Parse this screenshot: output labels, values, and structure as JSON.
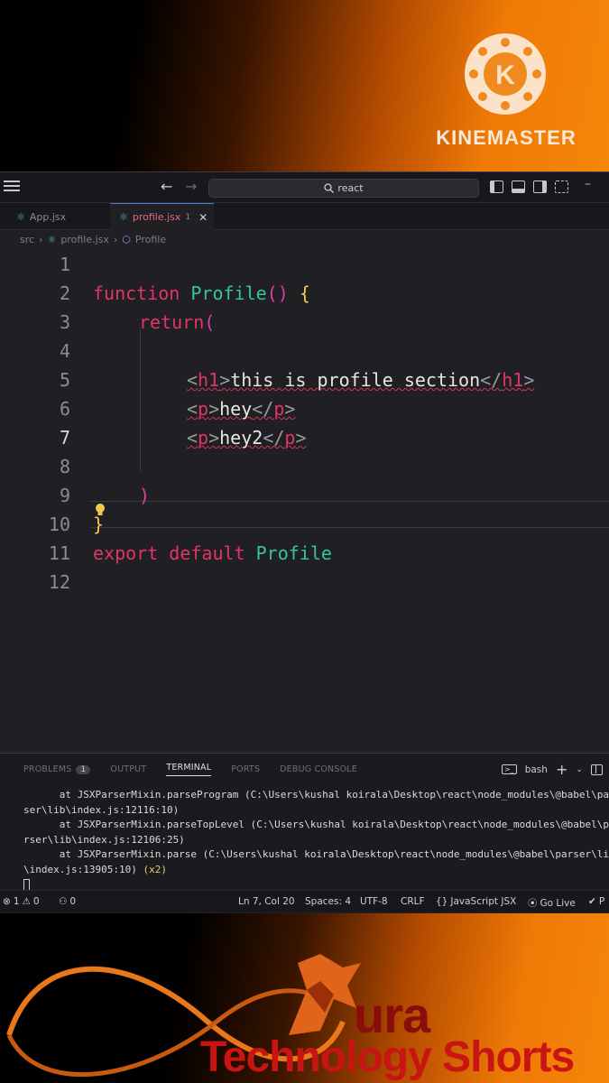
{
  "watermark": {
    "brand": "KINEMASTER"
  },
  "titlebar": {
    "search_text": "react"
  },
  "tabs": [
    {
      "label": "App.jsx"
    },
    {
      "label": "profile.jsx",
      "badge": "1"
    }
  ],
  "breadcrumb": [
    "src",
    "profile.jsx",
    "Profile"
  ],
  "code": {
    "line_numbers": [
      "1",
      "2",
      "3",
      "4",
      "5",
      "6",
      "7",
      "8",
      "9",
      "10",
      "11",
      "12"
    ],
    "l2": {
      "kw": "function",
      "fn": "Profile",
      "paren": "()",
      "brace": "{"
    },
    "l3": {
      "kw": "return",
      "paren": "("
    },
    "l5": {
      "lt": "<",
      "tag_open": "h1",
      "gt": ">",
      "text": "this is profile section",
      "lt2": "</",
      "tag_close": "h1",
      "gt2": ">"
    },
    "l6": {
      "lt": "<",
      "tag_open": "p",
      "gt": ">",
      "text": "hey",
      "lt2": "</",
      "tag_close": "p",
      "gt2": ">"
    },
    "l7": {
      "lt": "<",
      "tag_open": "p",
      "gt": ">",
      "text": "hey2",
      "lt2": "</",
      "tag_close": "p",
      "gt2": ">"
    },
    "l9": {
      "paren": ")"
    },
    "l10": {
      "brace": "}"
    },
    "l11": {
      "kw1": "export",
      "kw2": "default",
      "fn": "Profile"
    }
  },
  "panel": {
    "tabs": [
      "PROBLEMS",
      "OUTPUT",
      "TERMINAL",
      "PORTS",
      "DEBUG CONSOLE"
    ],
    "problems_count": "1",
    "shell": "bash",
    "terminal_lines": [
      "      at JSXParserMixin.parseProgram (C:\\Users\\kushal koirala\\Desktop\\react\\node_modules\\@babel\\pa",
      "ser\\lib\\index.js:12116:10)",
      "      at JSXParserMixin.parseTopLevel (C:\\Users\\kushal koirala\\Desktop\\react\\node_modules\\@babel\\p",
      "rser\\lib\\index.js:12106:25)",
      "      at JSXParserMixin.parse (C:\\Users\\kushal koirala\\Desktop\\react\\node_modules\\@babel\\parser\\lib",
      "\\index.js:13905:10)"
    ],
    "repeat": "(x2)"
  },
  "status_bar": {
    "errors": "1",
    "warnings": "0",
    "ports": "0",
    "position": "Ln 7, Col 20",
    "spaces": "Spaces: 4",
    "encoding": "UTF-8",
    "eol": "CRLF",
    "language": "JavaScript JSX",
    "golive": "Go Live",
    "prettier": "P"
  },
  "branding": {
    "aura": "ura",
    "channel": "Technology Shorts"
  }
}
